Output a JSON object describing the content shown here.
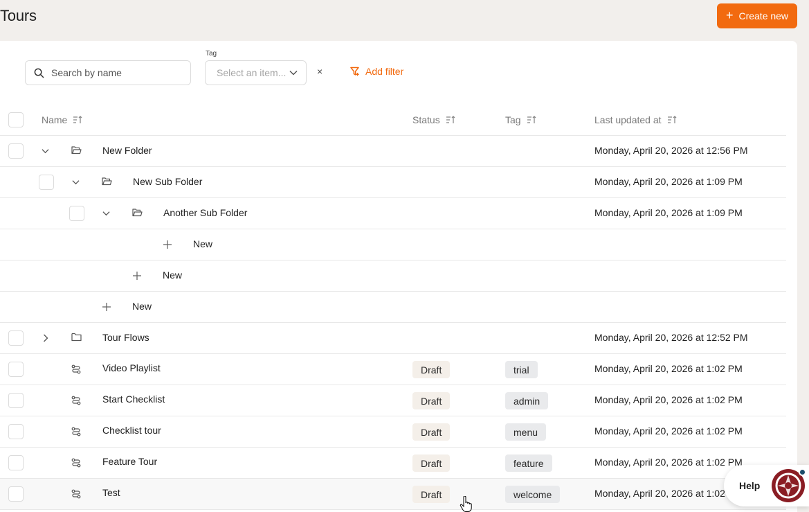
{
  "page": {
    "title": "Tours"
  },
  "header": {
    "create_label": "Create new"
  },
  "filters": {
    "search_placeholder": "Search by name",
    "tag_label": "Tag",
    "tag_placeholder": "Select an item...",
    "clear": "×",
    "add_filter": "Add filter"
  },
  "columns": {
    "name": "Name",
    "status": "Status",
    "tag": "Tag",
    "updated": "Last updated at"
  },
  "rows": [
    {
      "type": "folder",
      "level": 0,
      "expanded": true,
      "name": "New Folder",
      "updated": "Monday, April 20, 2026 at 12:56 PM"
    },
    {
      "type": "folder",
      "level": 1,
      "expanded": true,
      "name": "New Sub Folder",
      "updated": "Monday, April 20, 2026 at 1:09 PM"
    },
    {
      "type": "folder",
      "level": 2,
      "expanded": true,
      "name": "Another Sub Folder",
      "updated": "Monday, April 20, 2026 at 1:09 PM"
    },
    {
      "type": "new",
      "level": 3,
      "name": "New"
    },
    {
      "type": "new",
      "level": 2,
      "name": "New"
    },
    {
      "type": "new",
      "level": 1,
      "name": "New"
    },
    {
      "type": "folder",
      "level": 0,
      "expanded": false,
      "name": "Tour Flows",
      "updated": "Monday, April 20, 2026 at 12:52 PM"
    },
    {
      "type": "tour",
      "name": "Video Playlist",
      "status": "Draft",
      "tag": "trial",
      "updated": "Monday, April 20, 2026 at 1:02 PM"
    },
    {
      "type": "tour",
      "name": "Start Checklist",
      "status": "Draft",
      "tag": "admin",
      "updated": "Monday, April 20, 2026 at 1:02 PM"
    },
    {
      "type": "tour",
      "name": "Checklist tour",
      "status": "Draft",
      "tag": "menu",
      "updated": "Monday, April 20, 2026 at 1:02 PM"
    },
    {
      "type": "tour",
      "name": "Feature Tour",
      "status": "Draft",
      "tag": "feature",
      "updated": "Monday, April 20, 2026 at 1:02 PM"
    },
    {
      "type": "tour",
      "name": "Test",
      "status": "Draft",
      "tag": "welcome",
      "updated": "Monday, April 20, 2026 at 1:02 PM"
    }
  ],
  "help": {
    "label": "Help"
  },
  "colors": {
    "accent": "#f26a0f",
    "status_badge": "#f4efe9",
    "tag_badge": "#e9eaec"
  }
}
